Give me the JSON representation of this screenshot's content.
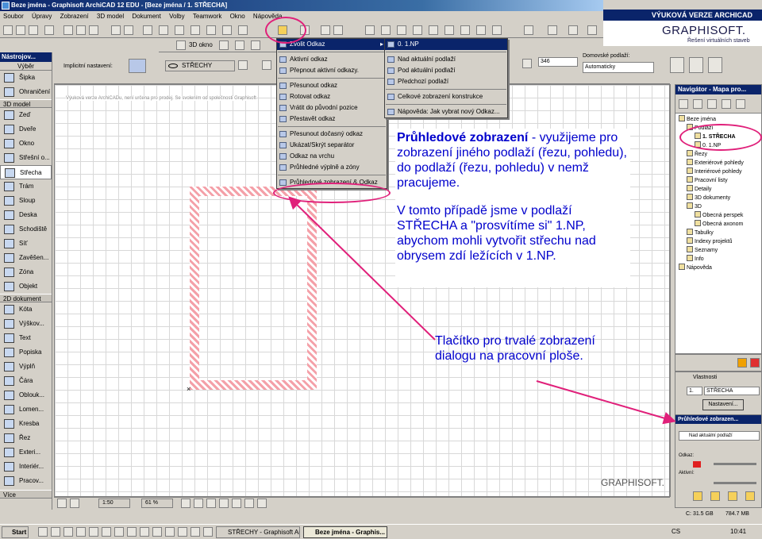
{
  "window": {
    "title": "Beze jména - Graphisoft ArchiCAD 12 EDU - [Beze jména / 1. STŘECHA]"
  },
  "menubar": [
    "Soubor",
    "Úpravy",
    "Zobrazení",
    "3D model",
    "Dokument",
    "Volby",
    "Teamwork",
    "Okno",
    "Nápověda"
  ],
  "branding": {
    "edu_label": "VÝUKOVÁ VERZE ARCHICAD",
    "logo": "GRAPHISOFT.",
    "tagline": "Řešení virtuálních staveb",
    "watermark": "GRAPHISOFT."
  },
  "toolbox": {
    "header": "Nástrojov...",
    "select_label": "Výběr",
    "sections": {
      "design": "3D model",
      "document": "2D dokument"
    },
    "top_items": [
      "Šipka",
      "Ohraničení"
    ],
    "design_items": [
      "Zeď",
      "Dveře",
      "Okno",
      "Střešní o...",
      "Střecha",
      "Trám",
      "Sloup",
      "Deska",
      "Schodiště",
      "Síť",
      "Zavěšen...",
      "Zóna",
      "Objekt"
    ],
    "document_items": [
      "Kóta",
      "Výškov...",
      "Text",
      "Popiska",
      "Výplň",
      "Čára",
      "Oblouk...",
      "Lomen...",
      "Kresba",
      "Řez",
      "Exteri...",
      "Interiér...",
      "Pracov..."
    ],
    "more_label": "Více",
    "selected": "Střecha"
  },
  "infobox": {
    "default_label": "Implicitní nastavení:",
    "layer_label": "STŘECHY",
    "value": "346",
    "home_story_label": "Domovské podlaží:",
    "home_story_value": "Automaticky"
  },
  "toolbar_top": {
    "view3d_label": "3D okno"
  },
  "canvas": {
    "edu_note": "Výuková verze ArchiCADu, není určena pro prodej. Se svolením od společnosti Graphisoft"
  },
  "menus": {
    "main": [
      {
        "label": "Zvolit Odkaz",
        "highlight": true,
        "submenu": true
      },
      {
        "sep": true
      },
      {
        "label": "Aktivní odkaz"
      },
      {
        "label": "Přepnout aktivní odkazy."
      },
      {
        "sep": true
      },
      {
        "label": "Přesunout odkaz"
      },
      {
        "label": "Rotovat odkaz"
      },
      {
        "label": "Vrátit do původní pozice"
      },
      {
        "label": "Přestavět odkaz"
      },
      {
        "sep": true
      },
      {
        "label": "Přesunout dočasný odkaz"
      },
      {
        "label": "Ukázat/Skrýt separátor"
      },
      {
        "label": "Odkaz na vrchu"
      },
      {
        "label": "Průhledné výplně a zóny"
      },
      {
        "sep": true
      },
      {
        "label": "Průhledové zobrazení & Odkaz"
      }
    ],
    "sub": [
      {
        "label": "0. 1.NP",
        "highlight": true
      },
      {
        "sep": true
      },
      {
        "label": "Nad aktuální podlaží"
      },
      {
        "label": "Pod aktuální podlaží"
      },
      {
        "label": "Předchozí podlaží"
      },
      {
        "sep": true
      },
      {
        "label": "Celkové zobrazení konstrukce"
      },
      {
        "sep": true
      },
      {
        "label": "Nápověda: Jak vybrat nový Odkaz..."
      }
    ]
  },
  "navigator": {
    "header": "Navigátor - Mapa pro...",
    "items": [
      {
        "label": "Beze jména",
        "indent": 0
      },
      {
        "label": "Podlaží",
        "indent": 1
      },
      {
        "label": "1. STŘECHA",
        "indent": 2,
        "highlight": true
      },
      {
        "label": "0. 1.NP",
        "indent": 2
      },
      {
        "label": "Řezy",
        "indent": 1
      },
      {
        "label": "Exteriérové pohledy",
        "indent": 1
      },
      {
        "label": "Interiérové pohledy",
        "indent": 1
      },
      {
        "label": "Pracovní listy",
        "indent": 1
      },
      {
        "label": "Detaily",
        "indent": 1
      },
      {
        "label": "3D dokumenty",
        "indent": 1
      },
      {
        "label": "3D",
        "indent": 1
      },
      {
        "label": "Obecná perspek",
        "indent": 2
      },
      {
        "label": "Obecná axonom",
        "indent": 2
      },
      {
        "label": "Tabulky",
        "indent": 1
      },
      {
        "label": "Indexy projektů",
        "indent": 1
      },
      {
        "label": "Seznamy",
        "indent": 1
      },
      {
        "label": "Info",
        "indent": 1
      },
      {
        "label": "Nápověda",
        "indent": 0
      }
    ]
  },
  "properties": {
    "header": "Vlastnosti",
    "story_num": "1.",
    "story_name": "STŘECHA",
    "settings_button": "Nastavení..."
  },
  "trace_panel": {
    "header": "Průhledové zobrazen...",
    "mode": "Nad aktuální podlaží",
    "reference_label": "Odkaz:",
    "active_label": "Aktivní:"
  },
  "scale_bar": {
    "scale": "1:50",
    "zoom": "61 %"
  },
  "status": {
    "disk": "C: 31.5 GB",
    "memory": "784.7 MB"
  },
  "annotations": {
    "main_title": "Průhledové zobrazení",
    "main_rest": " - využijeme pro zobrazení jiného podlaží (řezu, pohledu), do podlaží (řezu, pohledu) v nemž pracujeme.",
    "main_p2": "V tomto případě jsme v podlaží STŘECHA a \"prosvítíme si\" 1.NP, abychom mohli vytvořit střechu nad obrysem zdí ležících v 1.NP.",
    "button_note": "Tlačítko pro trvalé zobrazení dialogu na pracovní ploše."
  },
  "taskbar": {
    "start": "Start",
    "buttons": [
      "STŘECHY - Graphisoft Ar...",
      "Beze jména - Graphis..."
    ],
    "lang": "CS",
    "time": "10:41"
  }
}
